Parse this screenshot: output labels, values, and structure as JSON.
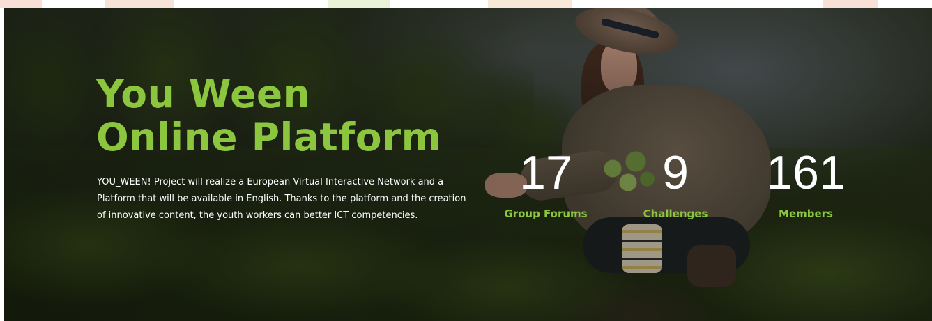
{
  "hero": {
    "title_line1": "You Ween",
    "title_line2": "Online Platform",
    "description": "YOU_WEEN! Project will realize a European Virtual Interactive Network and a Platform that will be available in English. Thanks to the platform and the creation of innovative content, the youth workers can better ICT competencies.",
    "accent_color": "#8cc63f",
    "text_color": "#ffffff"
  },
  "stats": [
    {
      "value": "17",
      "label": "Group Forums"
    },
    {
      "value": "9",
      "label": "Challenges"
    },
    {
      "value": "161",
      "label": "Members"
    }
  ]
}
